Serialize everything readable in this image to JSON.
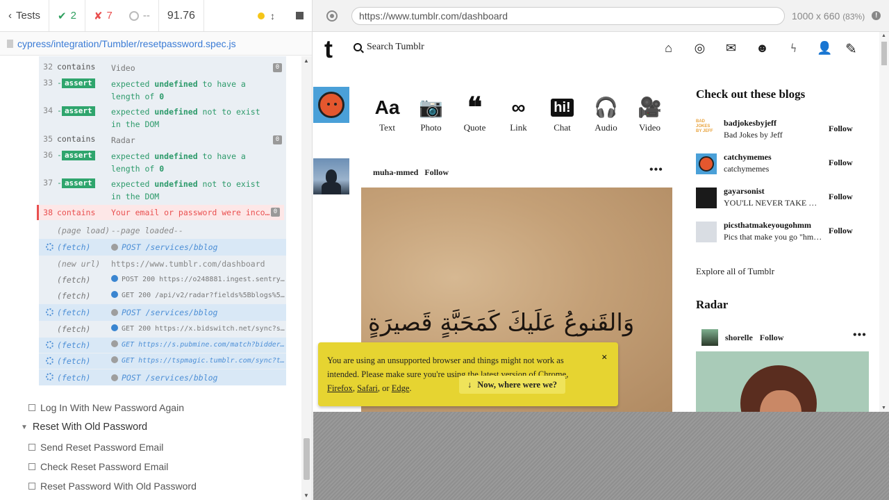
{
  "stats": {
    "tests_label": "Tests",
    "passed": "2",
    "failed": "7",
    "pending": "--",
    "duration": "91.76"
  },
  "spec_path": "cypress/integration/Tumbler/resetpassword.spec.js",
  "commands": [
    {
      "num": "32",
      "name": "contains",
      "msg": "Video",
      "count": "0"
    },
    {
      "num": "33",
      "name": "-assert",
      "msg_pre": "expected ",
      "msg_b": "undefined",
      "msg_post": " to have a length of ",
      "msg_b2": "0"
    },
    {
      "num": "34",
      "name": "-assert",
      "msg_pre": "expected ",
      "msg_b": "undefined",
      "msg_post": " not to exist in the DOM"
    },
    {
      "num": "35",
      "name": "contains",
      "msg": "Radar",
      "count": "0"
    },
    {
      "num": "36",
      "name": "-assert",
      "msg_pre": "expected ",
      "msg_b": "undefined",
      "msg_post": " to have a length of ",
      "msg_b2": "0"
    },
    {
      "num": "37",
      "name": "-assert",
      "msg_pre": "expected ",
      "msg_b": "undefined",
      "msg_post": " not to exist in the DOM"
    },
    {
      "num": "38",
      "name": "contains",
      "msg": "Your email or password were inco…",
      "count": "0"
    }
  ],
  "log": [
    {
      "name": "(page load)",
      "msg": "--page loaded--"
    },
    {
      "name": "(fetch)",
      "msg": "POST /services/bblog"
    },
    {
      "name": "(new url)",
      "msg": "https://www.tumblr.com/dashboard"
    },
    {
      "name": "(fetch)",
      "msg": "POST 200 https://o248881.ingest.sentry…"
    },
    {
      "name": "(fetch)",
      "msg": "GET 200 /api/v2/radar?fields%5Bblogs%5…"
    },
    {
      "name": "(fetch)",
      "msg": "POST /services/bblog"
    },
    {
      "name": "(fetch)",
      "msg": "GET 200 https://x.bidswitch.net/sync?s…"
    },
    {
      "name": "(fetch)",
      "msg": "GET https://s.pubmine.com/match?bidder…"
    },
    {
      "name": "(fetch)",
      "msg": "GET https://tspmagic.tumblr.com/sync?t…"
    },
    {
      "name": "(fetch)",
      "msg": "POST /services/bblog"
    }
  ],
  "tests": {
    "login_again": "Log In With New Password Again",
    "suite": "Reset With Old Password",
    "send_email": "Send Reset Password Email",
    "check_email": "Check Reset Password Email",
    "reset_old": "Reset Password With Old Password"
  },
  "browser": {
    "url": "https://www.tumblr.com/dashboard",
    "viewport": "1000 x 660",
    "zoom": "(83%)"
  },
  "tumblr": {
    "search": "Search Tumblr",
    "post_types": [
      "Text",
      "Photo",
      "Quote",
      "Link",
      "Chat",
      "Audio",
      "Video"
    ],
    "post_user": "muha-mmed",
    "follow": "Follow",
    "calligraphy": "وَالقَنوعُ عَلَيكَ كَمَحَبَّةٍ قَصيرَةٍ",
    "sidebar_title": "Check out these blogs",
    "blogs": [
      {
        "name": "badjokesbyjeff",
        "desc": "Bad Jokes by Jeff",
        "follow": "Follow",
        "avatar_text": "BAD JOKES BY JEFF"
      },
      {
        "name": "catchymemes",
        "desc": "catchymemes",
        "follow": "Follow"
      },
      {
        "name": "gayarsonist",
        "desc": "YOU'LL NEVER TAKE ME…",
        "follow": "Follow"
      },
      {
        "name": "picsthatmakeyougohmm",
        "desc": "Pics that make you go \"hmm\"",
        "follow": "Follow"
      }
    ],
    "explore": "Explore all of Tumblr",
    "radar_title": "Radar",
    "radar_user": "shorelle",
    "radar_follow": "Follow"
  },
  "banner": {
    "text1": "You are using an unsupported browser and things might not work as intended. Please make sure you're using the latest version of ",
    "chrome": "Chrome",
    "firefox": "Firefox",
    "safari": "Safari",
    "or": ", or ",
    "edge": "Edge",
    "button": "Now, where were we?",
    "close": "×"
  },
  "colors": {
    "pass": "#2e9f5e",
    "fail": "#e94f4f",
    "banner": "#e6d431"
  }
}
